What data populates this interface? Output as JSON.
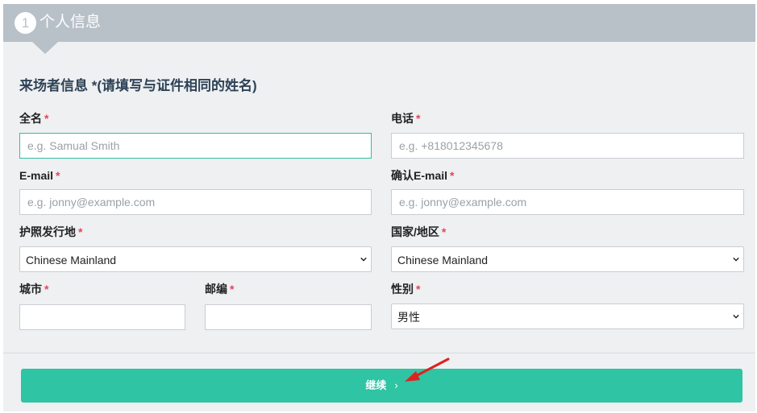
{
  "header": {
    "step_number": "1",
    "title": "个人信息"
  },
  "section_title": "来场者信息 *(请填写与证件相同的姓名)",
  "required_mark": "*",
  "fields": {
    "full_name": {
      "label": "全名",
      "placeholder": "e.g. Samual Smith"
    },
    "phone": {
      "label": "电话",
      "placeholder": "e.g. +818012345678"
    },
    "email": {
      "label": "E-mail",
      "placeholder": "e.g. jonny@example.com"
    },
    "confirm_email": {
      "label": "确认E-mail",
      "placeholder": "e.g. jonny@example.com"
    },
    "passport_country": {
      "label": "护照发行地",
      "value": "Chinese Mainland"
    },
    "country_region": {
      "label": "国家/地区",
      "value": "Chinese Mainland"
    },
    "city": {
      "label": "城市",
      "value": ""
    },
    "postal_code": {
      "label": "邮编",
      "value": ""
    },
    "gender": {
      "label": "性别",
      "value": "男性"
    }
  },
  "continue_button": {
    "label": "继续",
    "arrow": "›"
  },
  "colors": {
    "accent": "#2ec4a4",
    "header_bg": "#b8c0c8",
    "required": "#e3455a",
    "annotation": "#e02020"
  }
}
